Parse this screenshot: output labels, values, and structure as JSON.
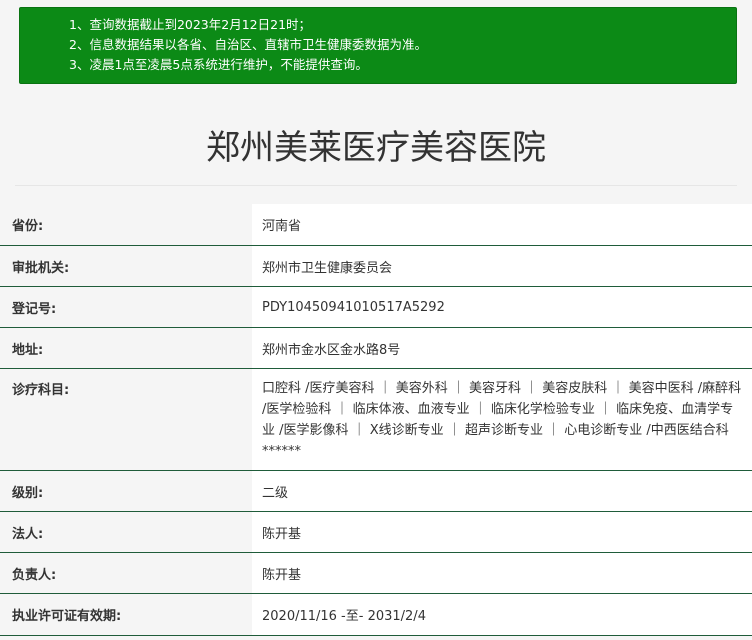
{
  "notice": {
    "lines": [
      "1、查询数据截止到2023年2月12日21时；",
      "2、信息数据结果以各省、自治区、直辖市卫生健康委数据为准。",
      "3、凌晨1点至凌晨5点系统进行维护，不能提供查询。"
    ]
  },
  "title": "郑州美莱医疗美容医院",
  "rows": [
    {
      "label": "省份:",
      "value": "河南省"
    },
    {
      "label": "审批机关:",
      "value": "郑州市卫生健康委员会"
    },
    {
      "label": "登记号:",
      "value": "PDY10450941010517A5292"
    },
    {
      "label": "地址:",
      "value": "郑州市金水区金水路8号"
    },
    {
      "label": "诊疗科目:",
      "value": "口腔科 /医疗美容科 ｜ 美容外科 ｜ 美容牙科 ｜ 美容皮肤科 ｜ 美容中医科 /麻醉科 /医学检验科 ｜ 临床体液、血液专业 ｜ 临床化学检验专业 ｜ 临床免疫、血清学专业 /医学影像科 ｜ X线诊断专业 ｜ 超声诊断专业 ｜ 心电诊断专业 /中西医结合科******"
    },
    {
      "label": "级别:",
      "value": "二级"
    },
    {
      "label": "法人:",
      "value": "陈开基"
    },
    {
      "label": "负责人:",
      "value": "陈开基"
    },
    {
      "label": "执业许可证有效期:",
      "value": "2020/11/16 -至- 2031/2/4"
    }
  ]
}
